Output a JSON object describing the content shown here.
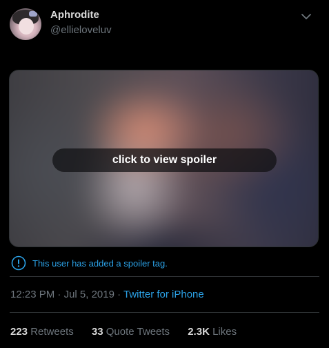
{
  "author": {
    "display_name": "Aphrodite",
    "handle": "@ellieloveluv",
    "avatar_icon": "user-avatar"
  },
  "menu": {
    "icon": "chevron-down-icon"
  },
  "media": {
    "spoiler_label": "click to view spoiler"
  },
  "notice": {
    "icon": "info-circle-icon",
    "text": "This user has added a spoiler tag."
  },
  "meta": {
    "time": "12:23 PM",
    "separator1": " · ",
    "date": "Jul 5, 2019",
    "separator2": " · ",
    "source": "Twitter for iPhone"
  },
  "stats": [
    {
      "count": "223",
      "label": "Retweets"
    },
    {
      "count": "33",
      "label": "Quote Tweets"
    },
    {
      "count": "2.3K",
      "label": "Likes"
    }
  ],
  "colors": {
    "background": "#000000",
    "link_blue": "#2ba1e6",
    "secondary_text": "#6e767d",
    "primary_text": "#d9d9d9",
    "divider": "#2f3336"
  }
}
